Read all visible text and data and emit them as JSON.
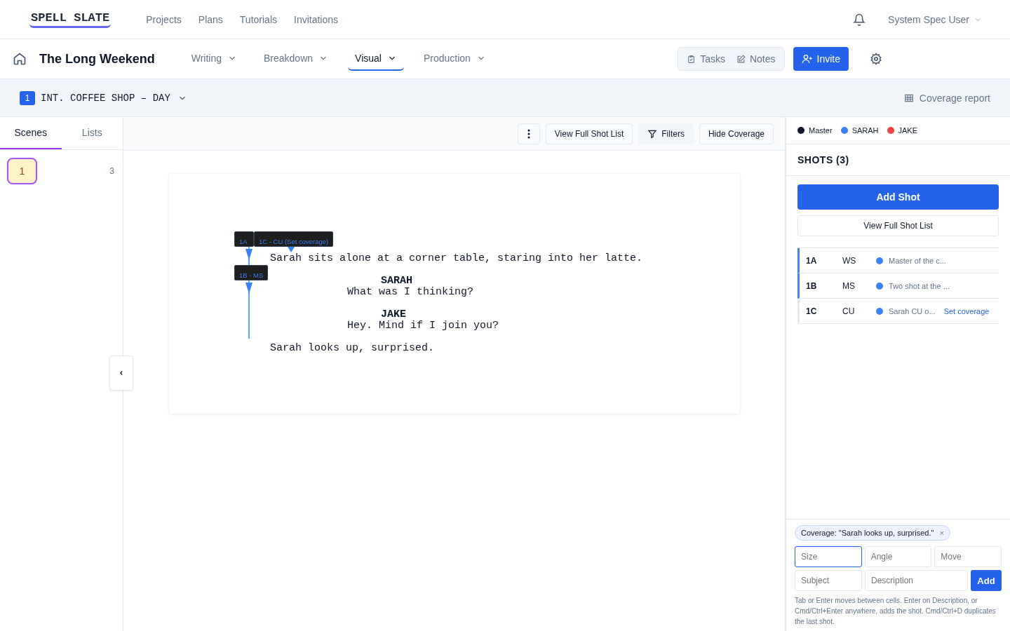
{
  "logo": "SPELL SLATE",
  "nav": [
    {
      "label": "Projects"
    },
    {
      "label": "Plans"
    },
    {
      "label": "Tutorials"
    },
    {
      "label": "Invitations"
    }
  ],
  "user": "System Spec User",
  "project_title": "The Long Weekend",
  "menus": [
    {
      "label": "Writing",
      "selected": false
    },
    {
      "label": "Breakdown",
      "selected": false
    },
    {
      "label": "Visual",
      "selected": true
    },
    {
      "label": "Production",
      "selected": false
    }
  ],
  "actions": {
    "tasks": "Tasks",
    "notes": "Notes",
    "invite": "Invite"
  },
  "scene": {
    "number": "1",
    "heading": "INT. COFFEE SHOP – DAY",
    "coverage_report": "Coverage report"
  },
  "side_tabs": [
    {
      "label": "Scenes",
      "selected": true
    },
    {
      "label": "Lists",
      "selected": false
    }
  ],
  "scenes": [
    {
      "number": "1",
      "count": "3",
      "selected": true
    }
  ],
  "toolbar": {
    "view_full": "View Full Shot List",
    "filters": "Filters",
    "hide": "Hide Coverage"
  },
  "script": [
    {
      "kind": "action",
      "text": "Sarah sits alone at a corner table, staring into her latte."
    },
    {
      "kind": "character",
      "text": "SARAH"
    },
    {
      "kind": "dialogue",
      "text": "What was I thinking?"
    },
    {
      "kind": "character",
      "text": "JAKE"
    },
    {
      "kind": "dialogue",
      "text": "Hey. Mind if I join you?"
    },
    {
      "kind": "action",
      "text": "Sarah looks up, surprised."
    }
  ],
  "markers": [
    {
      "label": "1A"
    },
    {
      "label": "1C - CU (Set coverage)"
    },
    {
      "label": "1B - MS"
    }
  ],
  "legend": [
    {
      "name": "Master",
      "color": "#0f172a"
    },
    {
      "name": "SARAH",
      "color": "#3b82f6"
    },
    {
      "name": "JAKE",
      "color": "#ef4444"
    }
  ],
  "shots_title": "SHOTS (3)",
  "add_shot": "Add Shot",
  "view_full_list": "View Full Shot List",
  "shots": [
    {
      "id": "1A",
      "size": "WS",
      "color": "#3b82f6",
      "description": "Master of the c...",
      "covered": true
    },
    {
      "id": "1B",
      "size": "MS",
      "color": "#3b82f6",
      "description": "Two shot at the ...",
      "covered": true
    },
    {
      "id": "1C",
      "size": "CU",
      "color": "#3b82f6",
      "description": "Sarah CU o...",
      "covered": false,
      "link": "Set coverage"
    }
  ],
  "coverage_chip": "Coverage: \"Sarah looks up, surprised.\"",
  "chip_close": "×",
  "form": {
    "size": {
      "placeholder": "Size"
    },
    "angle": {
      "placeholder": "Angle"
    },
    "move": {
      "placeholder": "Move"
    },
    "subject": {
      "placeholder": "Subject"
    },
    "description": {
      "placeholder": "Description"
    },
    "add": "Add"
  },
  "hint": "Tab or Enter moves between cells. Enter on Description, or Cmd/Ctrl+Enter anywhere, adds the shot. Cmd/Ctrl+D duplicates the last shot."
}
